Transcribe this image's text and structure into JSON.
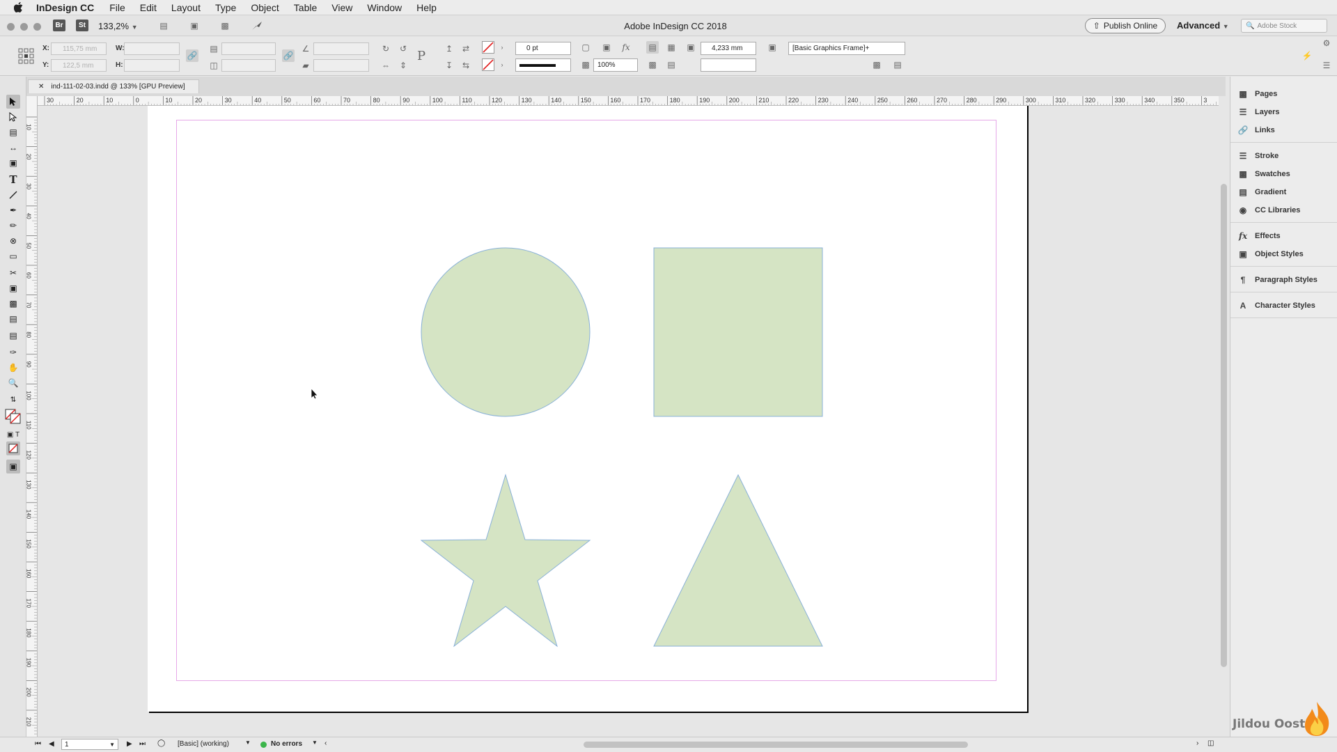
{
  "menubar": {
    "app_name": "InDesign CC",
    "items": [
      "File",
      "Edit",
      "Layout",
      "Type",
      "Object",
      "Table",
      "View",
      "Window",
      "Help"
    ]
  },
  "appbar": {
    "bridge": "Br",
    "stock": "St",
    "zoom": "133,2%",
    "title": "Adobe InDesign CC 2018",
    "publish": "Publish Online",
    "workspace": "Advanced",
    "search_placeholder": "Adobe Stock"
  },
  "control": {
    "x_label": "X:",
    "y_label": "Y:",
    "w_label": "W:",
    "h_label": "H:",
    "x_value": "115,75 mm",
    "y_value": "122,5 mm",
    "stroke_weight": "0 pt",
    "opacity": "100%",
    "fitting_value": "4,233 mm",
    "object_style": "[Basic Graphics Frame]+"
  },
  "document": {
    "tab_title": "ind-111-02-03.indd @ 133% [GPU Preview]"
  },
  "rulers": {
    "h_labels": [
      "30",
      "20",
      "10",
      "0",
      "10",
      "20",
      "30",
      "40",
      "50",
      "60",
      "70",
      "80",
      "90",
      "100",
      "110",
      "120",
      "130",
      "140",
      "150",
      "160",
      "170",
      "180",
      "190",
      "200",
      "210",
      "220",
      "230",
      "240",
      "250",
      "260",
      "270",
      "280",
      "290",
      "300",
      "310",
      "320",
      "330",
      "340",
      "350",
      "3"
    ],
    "v_labels": [
      "10",
      "20",
      "30",
      "40",
      "50",
      "60",
      "70",
      "80",
      "90",
      "100",
      "110",
      "120",
      "130",
      "140",
      "150",
      "160",
      "170",
      "180",
      "190",
      "200",
      "210"
    ]
  },
  "artwork": {
    "fill": "#d5e4c4",
    "stroke": "#88b0d8",
    "shapes": [
      "circle",
      "square",
      "star",
      "triangle"
    ]
  },
  "panels": {
    "groups": [
      [
        {
          "label": "Pages",
          "icon": "pages-icon"
        },
        {
          "label": "Layers",
          "icon": "layers-icon"
        },
        {
          "label": "Links",
          "icon": "links-icon"
        }
      ],
      [
        {
          "label": "Stroke",
          "icon": "stroke-icon"
        },
        {
          "label": "Swatches",
          "icon": "swatches-icon"
        },
        {
          "label": "Gradient",
          "icon": "gradient-icon"
        },
        {
          "label": "CC Libraries",
          "icon": "cc-libraries-icon"
        }
      ],
      [
        {
          "label": "Effects",
          "icon": "effects-icon"
        },
        {
          "label": "Object Styles",
          "icon": "object-styles-icon"
        }
      ],
      [
        {
          "label": "Paragraph Styles",
          "icon": "paragraph-styles-icon"
        }
      ],
      [
        {
          "label": "Character Styles",
          "icon": "character-styles-icon"
        }
      ]
    ]
  },
  "status": {
    "page": "1",
    "profile": "[Basic] (working)",
    "errors": "No errors"
  },
  "watermark": "Jildou Oost",
  "colors": {
    "margin_guide": "#e6a8e8",
    "no_errors": "#3bb54a"
  }
}
